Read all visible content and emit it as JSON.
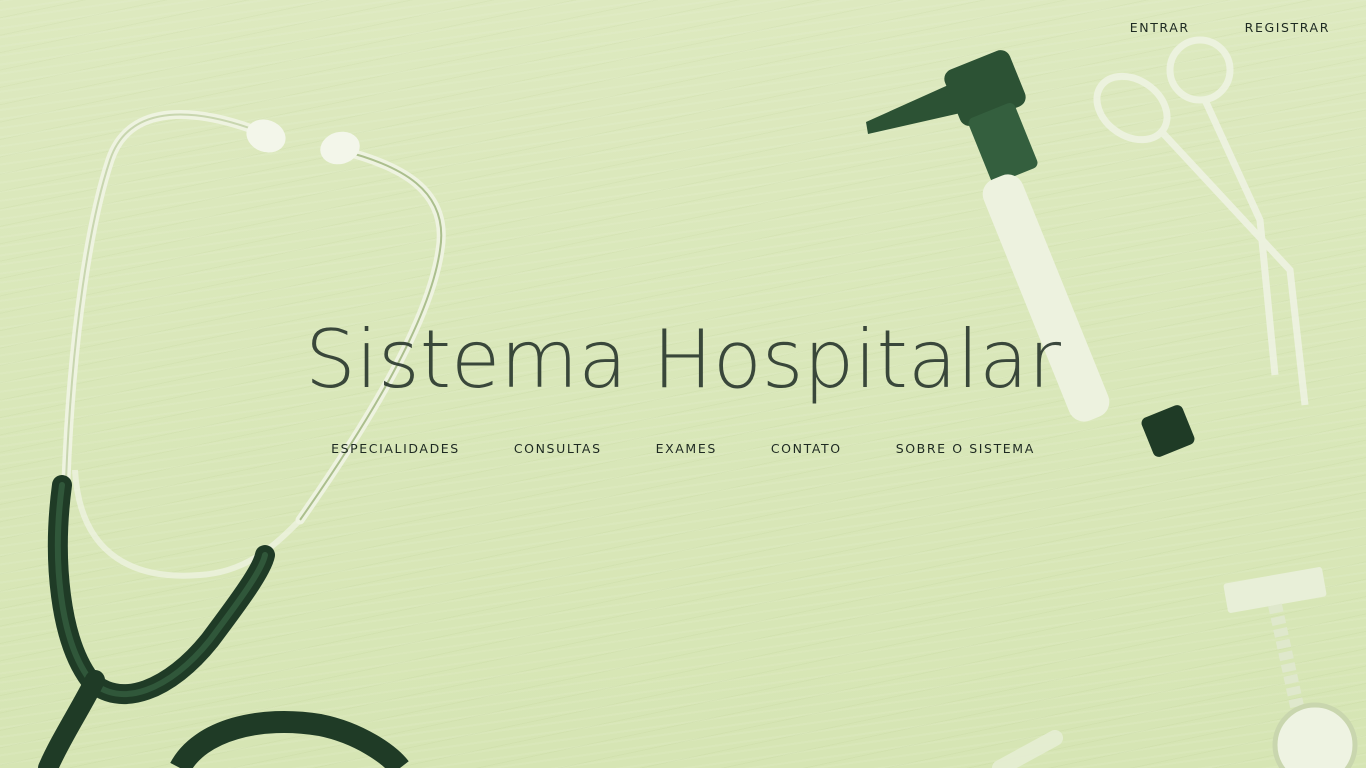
{
  "header": {
    "links": [
      {
        "label": "ENTRAR"
      },
      {
        "label": "REGISTRAR"
      }
    ]
  },
  "hero": {
    "title": "Sistema Hospitalar",
    "nav": [
      {
        "label": "ESPECIALIDADES"
      },
      {
        "label": "CONSULTAS"
      },
      {
        "label": "EXAMES"
      },
      {
        "label": "CONTATO"
      },
      {
        "label": "SOBRE O SISTEMA"
      }
    ]
  },
  "theme": {
    "background": "#dbe8bd",
    "text": "#1e2a22",
    "tool_dark": "#2f5a3a"
  },
  "icons": [
    "stethoscope-icon",
    "otoscope-icon",
    "scissors-icon",
    "fob-watch-icon"
  ]
}
